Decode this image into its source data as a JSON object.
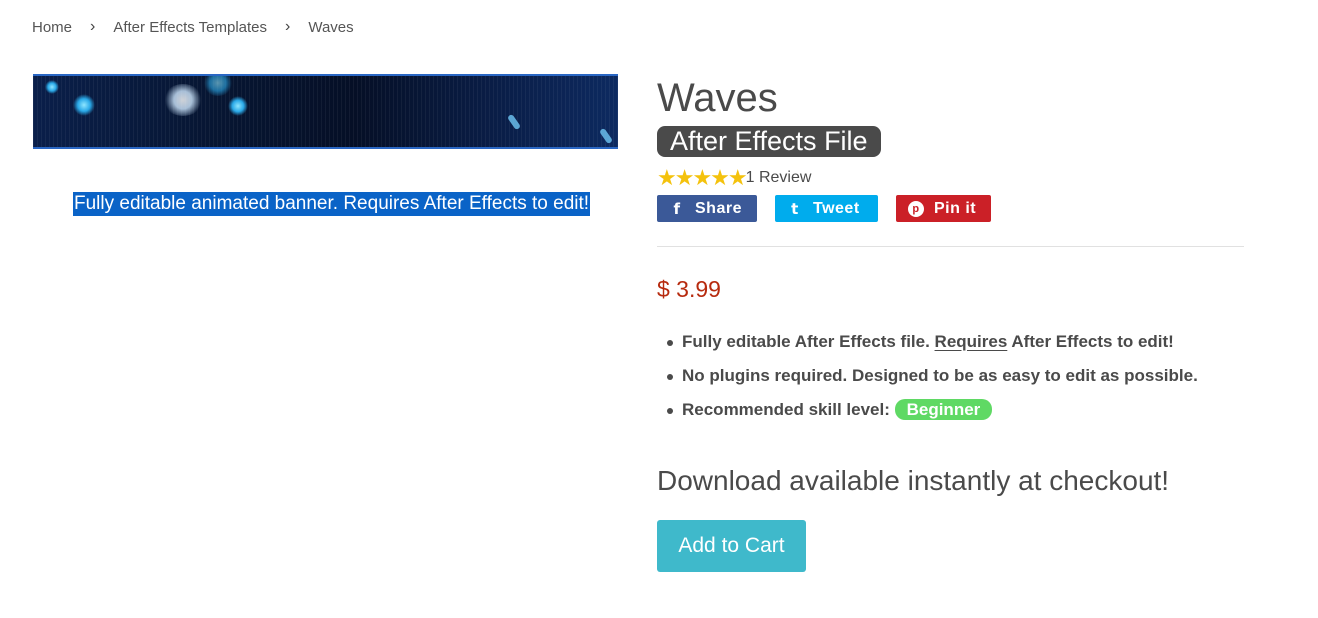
{
  "breadcrumb": {
    "home": "Home",
    "category": "After Effects Templates",
    "current": "Waves",
    "separator": "›"
  },
  "banner": {
    "caption": "Fully editable animated banner. Requires After Effects to edit!"
  },
  "product": {
    "title": "Waves",
    "file_badge": "After Effects File",
    "rating_stars": "★★★★★",
    "rating_value": 5,
    "review_text": "1 Review",
    "price": "$ 3.99"
  },
  "social": {
    "share_icon": "f",
    "share_label": "Share",
    "tweet_icon": "t",
    "tweet_label": "Tweet",
    "pin_icon": "p",
    "pin_label": "Pin it"
  },
  "features": {
    "item1_prefix": "Fully editable After Effects file. ",
    "item1_underlined": "Requires",
    "item1_suffix": " After Effects to edit!",
    "item2": "No plugins required. Designed to be as easy to edit as possible.",
    "item3_label": "Recommended skill level: ",
    "item3_badge": "Beginner"
  },
  "download_text": "Download available instantly at checkout!",
  "cart_label": "Add to Cart",
  "colors": {
    "price": "#b72b0f",
    "cart_button": "#3fb9cb",
    "facebook": "#3b5998",
    "twitter": "#00aced",
    "pinterest": "#cb2027",
    "skill_badge": "#5fd964",
    "stars": "#f4c20d"
  }
}
